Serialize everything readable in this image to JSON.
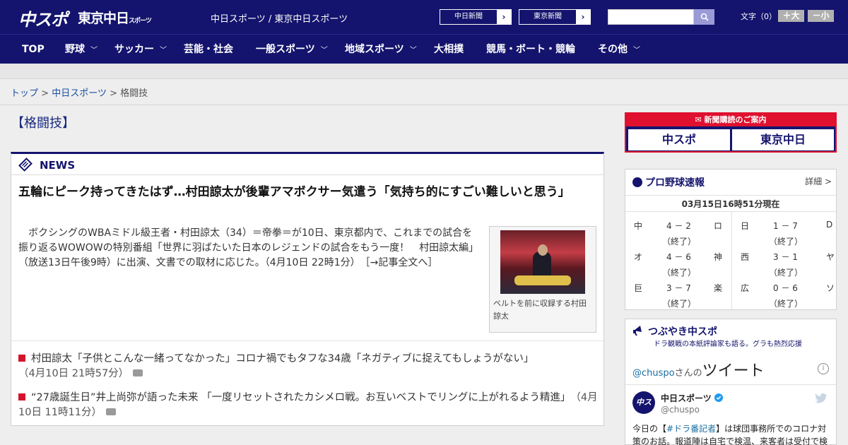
{
  "header": {
    "logo_chuspo": "中スポ",
    "logo_tokyo": "東京中日",
    "logo_tokyo_small": "スポーツ",
    "site_name": "中日スポーツ / 東京中日スポーツ",
    "paper_buttons": [
      "中日新聞",
      "東京新聞"
    ],
    "search_placeholder": "",
    "fontsize_label": "文字（0）",
    "fontsize_plus": "＋大",
    "fontsize_minus": "－小"
  },
  "nav": {
    "items": [
      {
        "label": "TOP",
        "dropdown": false
      },
      {
        "label": "野球",
        "dropdown": true
      },
      {
        "label": "サッカー",
        "dropdown": true
      },
      {
        "label": "芸能・社会",
        "dropdown": false
      },
      {
        "label": "一般スポーツ",
        "dropdown": true
      },
      {
        "label": "地域スポーツ",
        "dropdown": true
      },
      {
        "label": "大相撲",
        "dropdown": false
      },
      {
        "label": "競馬・ボート・競輪",
        "dropdown": false
      },
      {
        "label": "その他",
        "dropdown": true
      }
    ]
  },
  "breadcrumb": {
    "home": "トップ",
    "section": "中日スポーツ",
    "current": "格闘技",
    "sep": ">"
  },
  "category_title": "【格闘技】",
  "news": {
    "label": "NEWS",
    "headline": "五輪にピーク持ってきたはず…村田諒太が後輩アマボクサー気遣う「気持ち的にすごい難しいと思う」",
    "lead": "ボクシングのWBAミドル級王者・村田諒太（34）＝帝拳＝が10日、東京都内で、これまでの試合を振り返るWOWOWの特別番組「世界に羽ばたいた日本のレジェンドの試合をもう一度！　村田諒太編」（放送13日午後9時）に出演、文書での取材に応じた。（4月10日 22時1分）　［→記事全文へ］",
    "photo_caption": "ベルトを前に収録する村田諒太",
    "related": [
      {
        "title": "村田諒太「子供とこんな一緒ってなかった」コロナ禍でもタフな34歳「ネガティブに捉えてもしょうがない」",
        "date": "（4月10日 21時57分）"
      },
      {
        "title": "“27歳誕生日”井上尚弥が語った未来 「一度リセットされたカシメロ戦。お互いベストでリングに上がれるよう精進」",
        "date": "（4月10日 11時11分）"
      }
    ]
  },
  "sidebar": {
    "subscription": {
      "header": "新聞購読のご案内",
      "logos": [
        "中スポ",
        "東京中日"
      ]
    },
    "baseball": {
      "title": "プロ野球速報",
      "detail": "詳細 >",
      "timestamp": "03月15日16時51分現在",
      "games_left": [
        {
          "home": "中",
          "score": "4 － 2",
          "away": "ロ",
          "status": "（終了）"
        },
        {
          "home": "オ",
          "score": "4 － 6",
          "away": "神",
          "status": "（終了）"
        },
        {
          "home": "巨",
          "score": "3 － 7",
          "away": "楽",
          "status": "（終了）"
        }
      ],
      "games_right": [
        {
          "home": "日",
          "score": "1 － 7",
          "away": "D",
          "status": "（終了）"
        },
        {
          "home": "西",
          "score": "3 － 1",
          "away": "ヤ",
          "status": "（終了）"
        },
        {
          "home": "広",
          "score": "0 － 6",
          "away": "ソ",
          "status": "（終了）"
        }
      ]
    },
    "twitter": {
      "title": "つぶやき中スポ",
      "subtitle": "ドラ観戦の本紙評論家も語る。グラも熱烈応援",
      "handle_link": "@chuspo",
      "handle_suffix": "さんの",
      "tweets_word": "ツイート",
      "account_name": "中日スポーツ",
      "account_handle": "@chuspo",
      "avatar_text": "中スポ",
      "tweet_prefix": "今日の【",
      "tweet_tag": "#ドラ番記者",
      "tweet_rest": "】は球団事務所でのコロナ対策のお話。報道陣は自宅で検温、来客者は受付で検"
    }
  },
  "colors": {
    "brand_navy": "#14146e",
    "accent_red": "#e0102f",
    "link_blue": "#1a4ea0"
  }
}
